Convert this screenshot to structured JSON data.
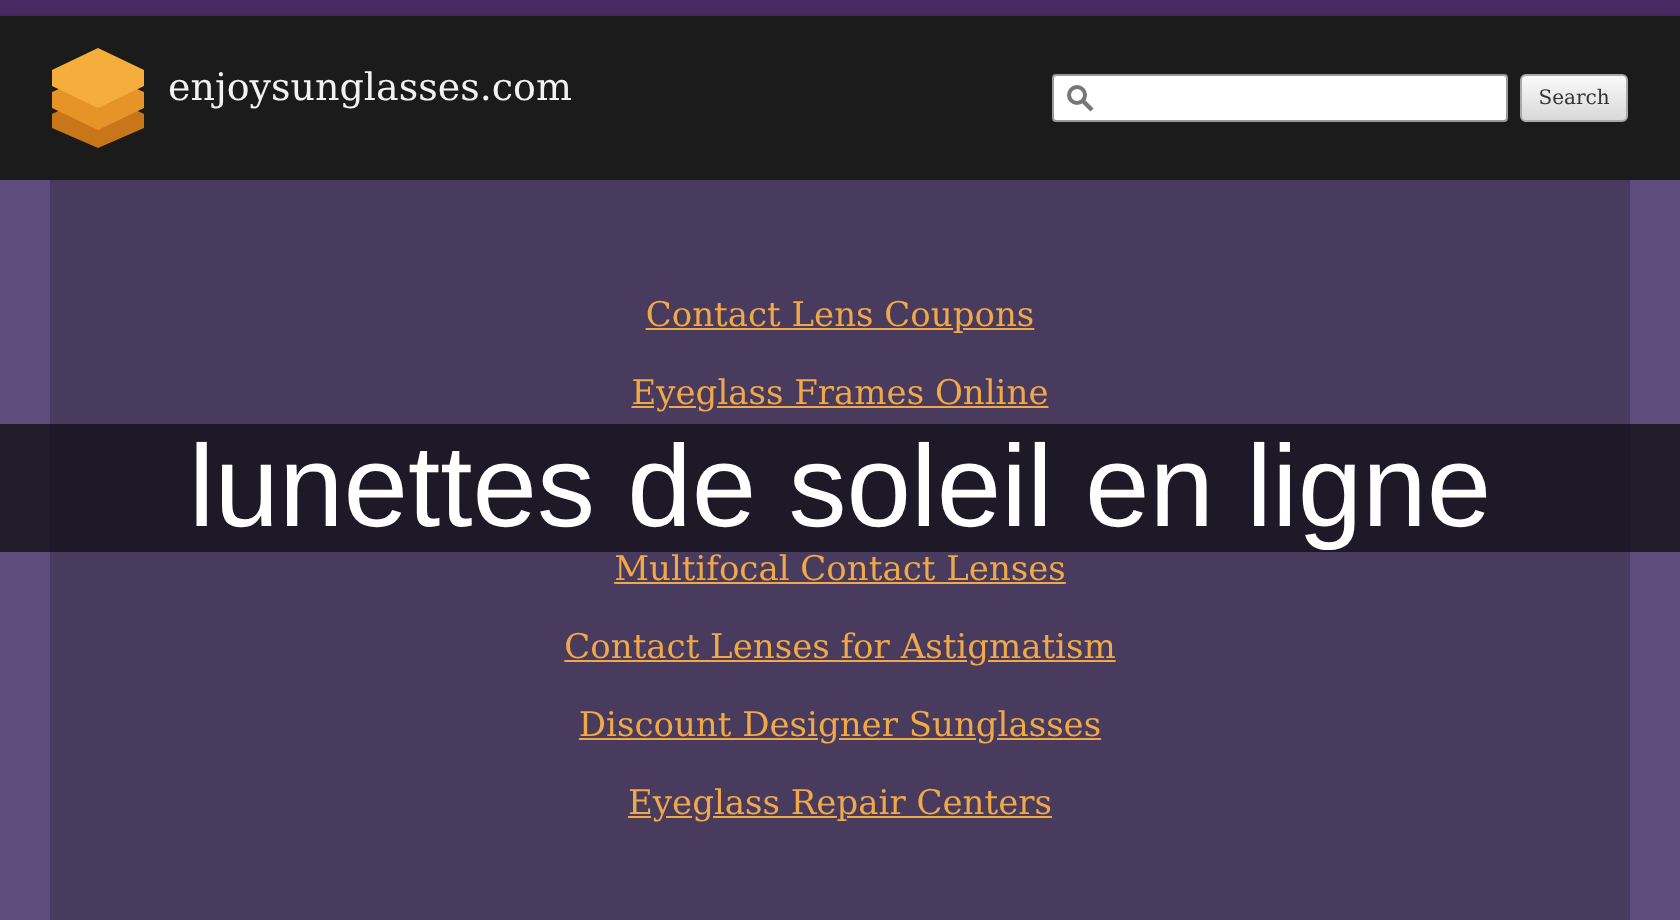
{
  "site": {
    "name": "enjoysunglasses.com"
  },
  "search": {
    "button": "Search"
  },
  "links": [
    {
      "label": "Contact Lens Coupons"
    },
    {
      "label": "Eyeglass Frames Online"
    },
    {
      "label": "Multifocal Contact Lenses"
    },
    {
      "label": "Contact Lenses for Astigmatism"
    },
    {
      "label": "Discount Designer Sunglasses"
    },
    {
      "label": "Eyeglass Repair Centers"
    }
  ],
  "overlay": {
    "title": "lunettes de soleil en ligne"
  }
}
